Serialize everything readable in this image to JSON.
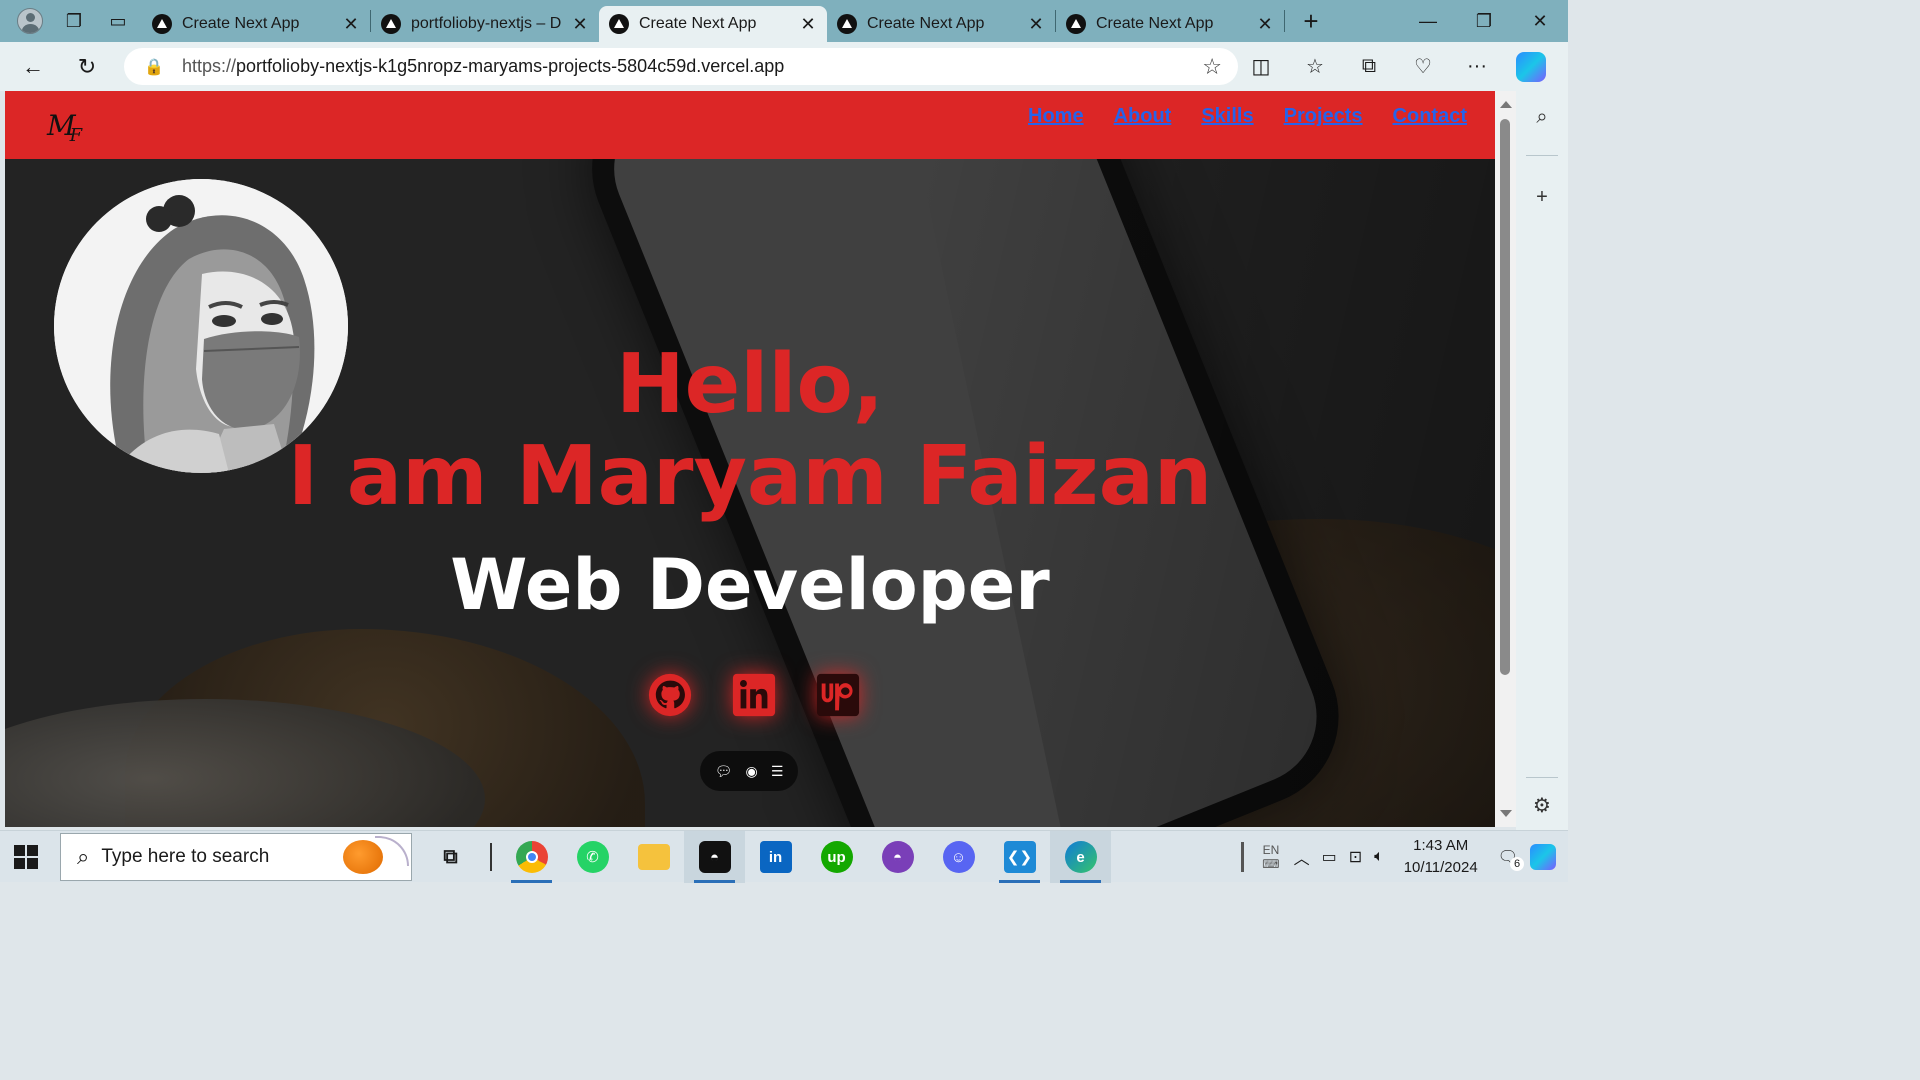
{
  "browser": {
    "tabs": [
      {
        "title": "Create Next App",
        "active": false
      },
      {
        "title": "portfolioby-nextjs – Dep",
        "active": false
      },
      {
        "title": "Create Next App",
        "active": true
      },
      {
        "title": "Create Next App",
        "active": false
      },
      {
        "title": "Create Next App",
        "active": false
      }
    ],
    "url_protocol": "https://",
    "url_rest": "portfolioby-nextjs-k1g5nropz-maryams-projects-5804c59d.vercel.app"
  },
  "site": {
    "logo_main": "M",
    "logo_sub": "F",
    "nav": [
      "Home",
      "About",
      "Skills",
      "Projects",
      "Contact"
    ],
    "hero": {
      "line1": "Hello,",
      "line2": "I am Maryam Faizan",
      "role": "Web Developer"
    },
    "socials": [
      {
        "icon": "github-icon"
      },
      {
        "icon": "linkedin-icon"
      },
      {
        "icon": "upwork-icon"
      }
    ],
    "colors": {
      "accent": "#dc2626",
      "link": "#2563eb"
    }
  },
  "taskbar": {
    "search_placeholder": "Type here to search",
    "apps": [
      "task-view",
      "chrome",
      "whatsapp",
      "file-explorer",
      "github-desktop",
      "linkedin",
      "upwork",
      "github",
      "discord",
      "vscode",
      "edge"
    ],
    "language": "EN",
    "time": "1:43 AM",
    "date": "10/11/2024",
    "notifications": "6"
  }
}
